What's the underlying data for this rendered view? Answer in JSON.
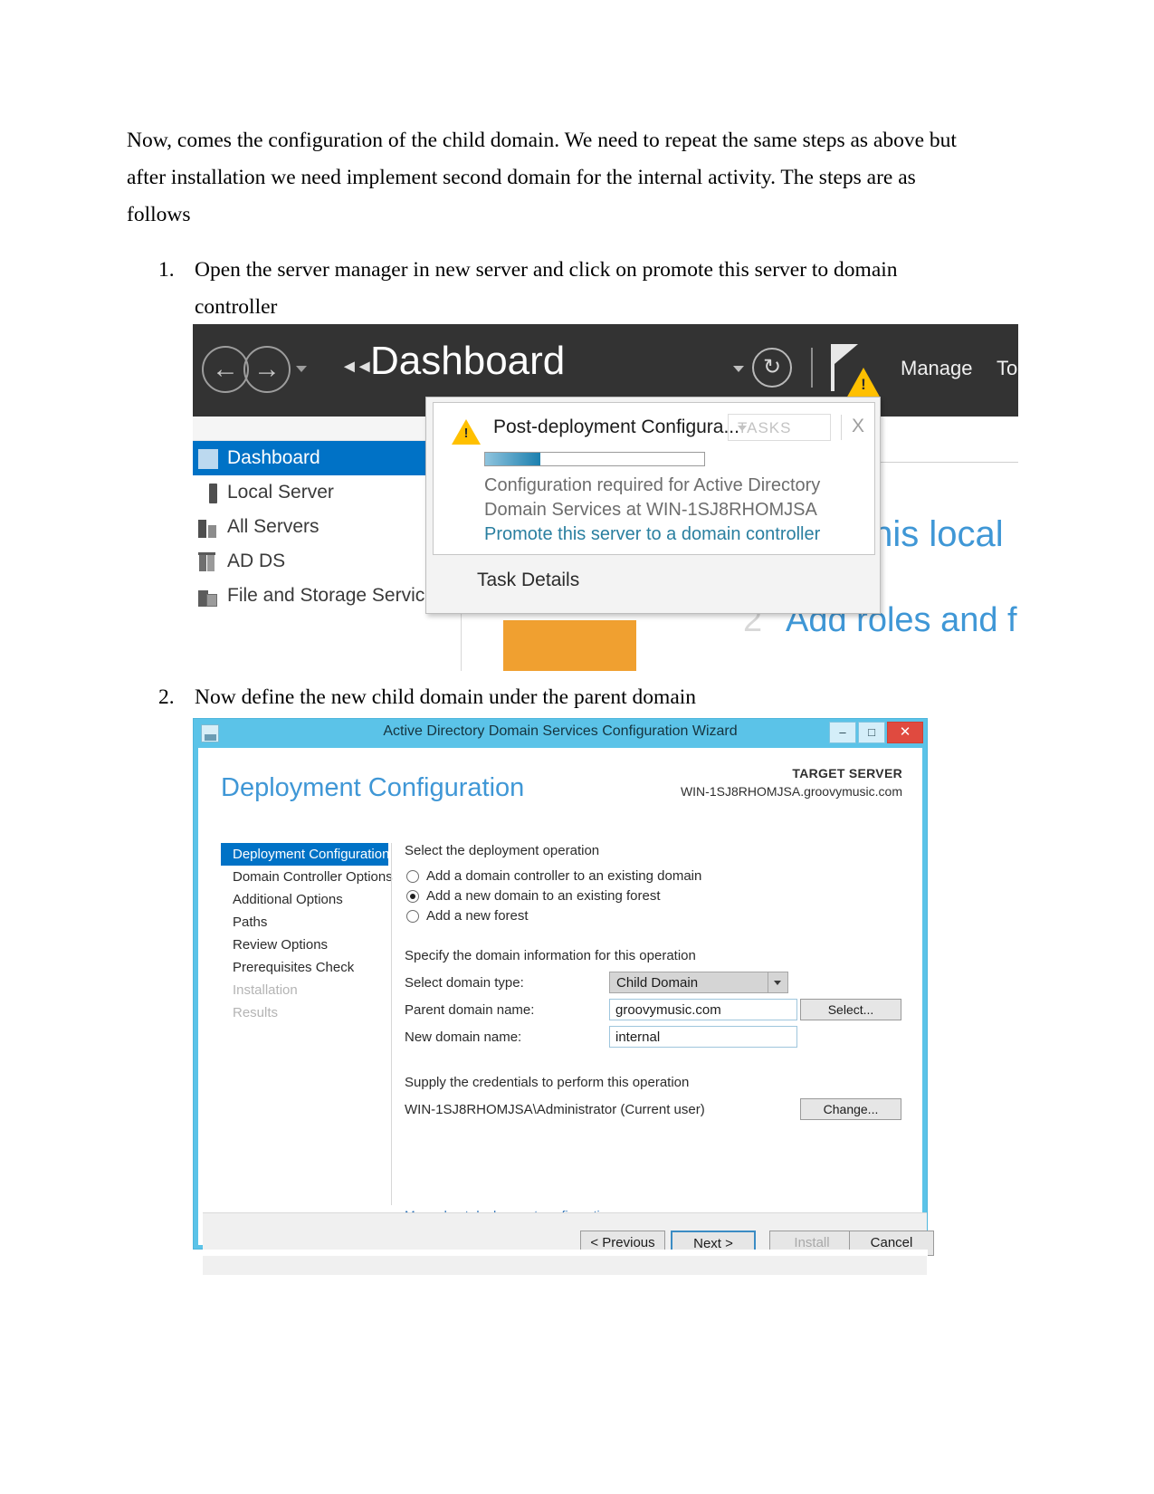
{
  "document": {
    "paragraph": "Now, comes the configuration of the child domain. We need to repeat the same steps as above but after installation we need implement second domain for the internal activity. The steps are as follows",
    "steps": [
      {
        "num": "1.",
        "text": "Open the server manager in new server and click on promote this server to domain controller"
      },
      {
        "num": "2.",
        "text": "Now define the new child domain under the parent domain"
      }
    ]
  },
  "server_manager": {
    "title": "Dashboard",
    "manage_label": "Manage",
    "tools_label": "Tools",
    "sidebar": [
      {
        "label": "Dashboard",
        "icon": "grid-icon"
      },
      {
        "label": "Local Server",
        "icon": "server-icon"
      },
      {
        "label": "All Servers",
        "icon": "servers-icon"
      },
      {
        "label": "AD DS",
        "icon": "adds-icon"
      },
      {
        "label": "File and Storage Service",
        "icon": "file-storage-icon"
      }
    ],
    "quick_start": {
      "local_text": "this local",
      "roles_number": "2",
      "roles_text": "Add roles and feature"
    },
    "notification": {
      "title": "Post-deployment Configura...",
      "tasks_label": "TASKS",
      "close_label": "X",
      "progress_percent": 25,
      "description": "Configuration required for Active Directory Domain Services at WIN-1SJ8RHOMJSA",
      "link": "Promote this server to a domain controller",
      "task_details": "Task Details"
    }
  },
  "wizard": {
    "window_title": "Active Directory Domain Services Configuration Wizard",
    "minimize_label": "–",
    "maximize_label": "□",
    "close_label": "✕",
    "page_heading": "Deployment Configuration",
    "target_server_label": "TARGET SERVER",
    "target_server_value": "WIN-1SJ8RHOMJSA.groovymusic.com",
    "steps": [
      {
        "label": "Deployment Configuration",
        "state": "active"
      },
      {
        "label": "Domain Controller Options",
        "state": "normal"
      },
      {
        "label": "Additional Options",
        "state": "normal"
      },
      {
        "label": "Paths",
        "state": "normal"
      },
      {
        "label": "Review Options",
        "state": "normal"
      },
      {
        "label": "Prerequisites Check",
        "state": "normal"
      },
      {
        "label": "Installation",
        "state": "dim"
      },
      {
        "label": "Results",
        "state": "dim"
      }
    ],
    "operation_section_label": "Select the deployment operation",
    "operations": [
      {
        "label": "Add a domain controller to an existing domain",
        "selected": false
      },
      {
        "label": "Add a new domain to an existing forest",
        "selected": true
      },
      {
        "label": "Add a new forest",
        "selected": false
      }
    ],
    "domain_section_label": "Specify the domain information for this operation",
    "fields": {
      "domain_type_label": "Select domain type:",
      "domain_type_value": "Child Domain",
      "parent_domain_label": "Parent domain name:",
      "parent_domain_value": "groovymusic.com",
      "select_button": "Select...",
      "new_domain_label": "New domain name:",
      "new_domain_value": "internal"
    },
    "credentials_section_label": "Supply the credentials to perform this operation",
    "credentials_value": "WIN-1SJ8RHOMJSA\\Administrator (Current user)",
    "change_button": "Change...",
    "more_link": "More about deployment configurations",
    "footer_buttons": {
      "previous": "< Previous",
      "next": "Next >",
      "install": "Install",
      "cancel": "Cancel"
    }
  },
  "colors": {
    "accent_blue": "#0072c6",
    "title_blue": "#3f97d6",
    "window_chrome": "#5bc3e8",
    "warning_yellow": "#ffc000",
    "close_red": "#e04a3f",
    "orange_tile": "#f0a030"
  }
}
